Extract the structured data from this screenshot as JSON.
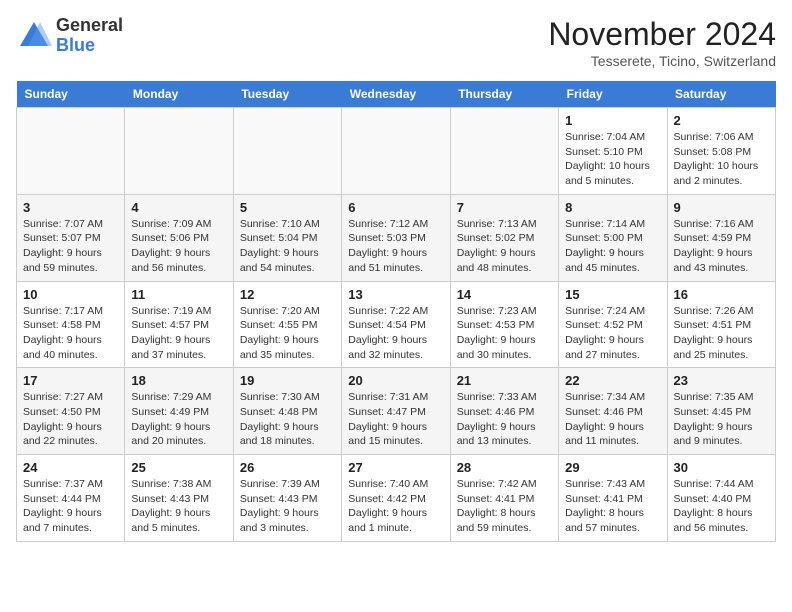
{
  "logo": {
    "general": "General",
    "blue": "Blue"
  },
  "header": {
    "month": "November 2024",
    "location": "Tesserete, Ticino, Switzerland"
  },
  "weekdays": [
    "Sunday",
    "Monday",
    "Tuesday",
    "Wednesday",
    "Thursday",
    "Friday",
    "Saturday"
  ],
  "weeks": [
    [
      {
        "day": "",
        "info": ""
      },
      {
        "day": "",
        "info": ""
      },
      {
        "day": "",
        "info": ""
      },
      {
        "day": "",
        "info": ""
      },
      {
        "day": "",
        "info": ""
      },
      {
        "day": "1",
        "info": "Sunrise: 7:04 AM\nSunset: 5:10 PM\nDaylight: 10 hours\nand 5 minutes."
      },
      {
        "day": "2",
        "info": "Sunrise: 7:06 AM\nSunset: 5:08 PM\nDaylight: 10 hours\nand 2 minutes."
      }
    ],
    [
      {
        "day": "3",
        "info": "Sunrise: 7:07 AM\nSunset: 5:07 PM\nDaylight: 9 hours\nand 59 minutes."
      },
      {
        "day": "4",
        "info": "Sunrise: 7:09 AM\nSunset: 5:06 PM\nDaylight: 9 hours\nand 56 minutes."
      },
      {
        "day": "5",
        "info": "Sunrise: 7:10 AM\nSunset: 5:04 PM\nDaylight: 9 hours\nand 54 minutes."
      },
      {
        "day": "6",
        "info": "Sunrise: 7:12 AM\nSunset: 5:03 PM\nDaylight: 9 hours\nand 51 minutes."
      },
      {
        "day": "7",
        "info": "Sunrise: 7:13 AM\nSunset: 5:02 PM\nDaylight: 9 hours\nand 48 minutes."
      },
      {
        "day": "8",
        "info": "Sunrise: 7:14 AM\nSunset: 5:00 PM\nDaylight: 9 hours\nand 45 minutes."
      },
      {
        "day": "9",
        "info": "Sunrise: 7:16 AM\nSunset: 4:59 PM\nDaylight: 9 hours\nand 43 minutes."
      }
    ],
    [
      {
        "day": "10",
        "info": "Sunrise: 7:17 AM\nSunset: 4:58 PM\nDaylight: 9 hours\nand 40 minutes."
      },
      {
        "day": "11",
        "info": "Sunrise: 7:19 AM\nSunset: 4:57 PM\nDaylight: 9 hours\nand 37 minutes."
      },
      {
        "day": "12",
        "info": "Sunrise: 7:20 AM\nSunset: 4:55 PM\nDaylight: 9 hours\nand 35 minutes."
      },
      {
        "day": "13",
        "info": "Sunrise: 7:22 AM\nSunset: 4:54 PM\nDaylight: 9 hours\nand 32 minutes."
      },
      {
        "day": "14",
        "info": "Sunrise: 7:23 AM\nSunset: 4:53 PM\nDaylight: 9 hours\nand 30 minutes."
      },
      {
        "day": "15",
        "info": "Sunrise: 7:24 AM\nSunset: 4:52 PM\nDaylight: 9 hours\nand 27 minutes."
      },
      {
        "day": "16",
        "info": "Sunrise: 7:26 AM\nSunset: 4:51 PM\nDaylight: 9 hours\nand 25 minutes."
      }
    ],
    [
      {
        "day": "17",
        "info": "Sunrise: 7:27 AM\nSunset: 4:50 PM\nDaylight: 9 hours\nand 22 minutes."
      },
      {
        "day": "18",
        "info": "Sunrise: 7:29 AM\nSunset: 4:49 PM\nDaylight: 9 hours\nand 20 minutes."
      },
      {
        "day": "19",
        "info": "Sunrise: 7:30 AM\nSunset: 4:48 PM\nDaylight: 9 hours\nand 18 minutes."
      },
      {
        "day": "20",
        "info": "Sunrise: 7:31 AM\nSunset: 4:47 PM\nDaylight: 9 hours\nand 15 minutes."
      },
      {
        "day": "21",
        "info": "Sunrise: 7:33 AM\nSunset: 4:46 PM\nDaylight: 9 hours\nand 13 minutes."
      },
      {
        "day": "22",
        "info": "Sunrise: 7:34 AM\nSunset: 4:46 PM\nDaylight: 9 hours\nand 11 minutes."
      },
      {
        "day": "23",
        "info": "Sunrise: 7:35 AM\nSunset: 4:45 PM\nDaylight: 9 hours\nand 9 minutes."
      }
    ],
    [
      {
        "day": "24",
        "info": "Sunrise: 7:37 AM\nSunset: 4:44 PM\nDaylight: 9 hours\nand 7 minutes."
      },
      {
        "day": "25",
        "info": "Sunrise: 7:38 AM\nSunset: 4:43 PM\nDaylight: 9 hours\nand 5 minutes."
      },
      {
        "day": "26",
        "info": "Sunrise: 7:39 AM\nSunset: 4:43 PM\nDaylight: 9 hours\nand 3 minutes."
      },
      {
        "day": "27",
        "info": "Sunrise: 7:40 AM\nSunset: 4:42 PM\nDaylight: 9 hours\nand 1 minute."
      },
      {
        "day": "28",
        "info": "Sunrise: 7:42 AM\nSunset: 4:41 PM\nDaylight: 8 hours\nand 59 minutes."
      },
      {
        "day": "29",
        "info": "Sunrise: 7:43 AM\nSunset: 4:41 PM\nDaylight: 8 hours\nand 57 minutes."
      },
      {
        "day": "30",
        "info": "Sunrise: 7:44 AM\nSunset: 4:40 PM\nDaylight: 8 hours\nand 56 minutes."
      }
    ]
  ]
}
